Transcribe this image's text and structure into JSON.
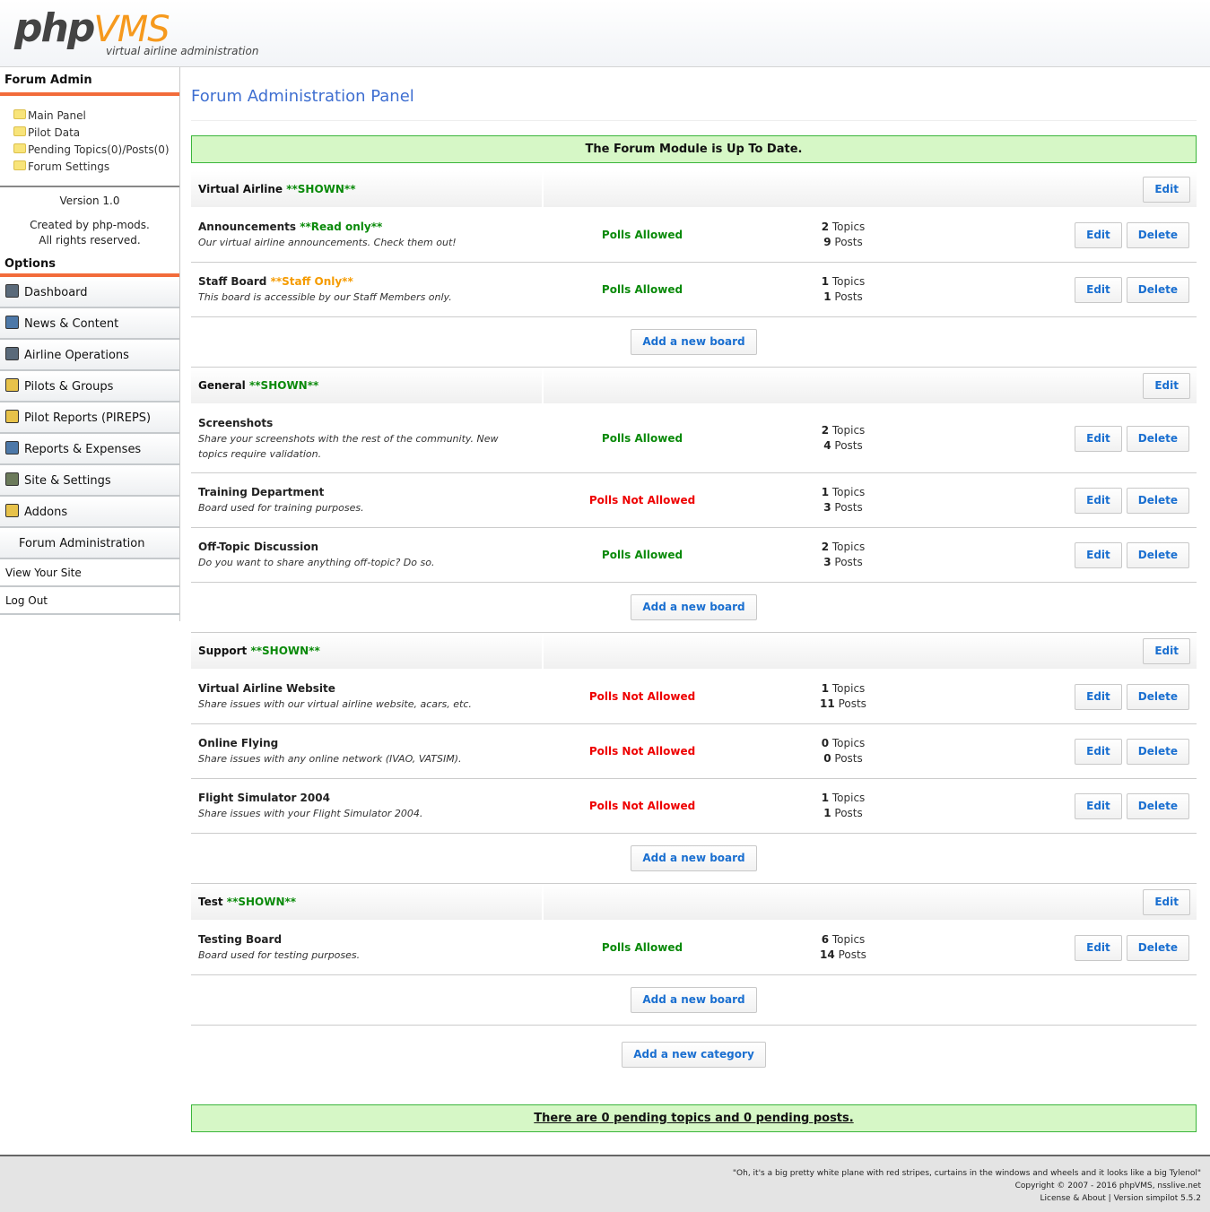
{
  "header": {
    "logo_php": "php",
    "logo_vms": "VMS",
    "tagline": "virtual airline administration"
  },
  "sidebar": {
    "title": "Forum Admin",
    "links": [
      {
        "label": "Main Panel"
      },
      {
        "label": "Pilot Data"
      },
      {
        "label": "Pending Topics(0)/Posts(0)"
      },
      {
        "label": "Forum Settings"
      }
    ],
    "version": "Version 1.0",
    "created_line1": "Created by php-mods.",
    "created_line2": "All rights reserved.",
    "options_title": "Options",
    "nav": [
      {
        "label": "Dashboard",
        "icon": "dashboard-icon"
      },
      {
        "label": "News & Content",
        "icon": "news-icon"
      },
      {
        "label": "Airline Operations",
        "icon": "airline-icon"
      },
      {
        "label": "Pilots & Groups",
        "icon": "pilots-icon"
      },
      {
        "label": "Pilot Reports (PIREPS)",
        "icon": "pireps-icon"
      },
      {
        "label": "Reports & Expenses",
        "icon": "reports-icon"
      },
      {
        "label": "Site & Settings",
        "icon": "settings-icon"
      },
      {
        "label": "Addons",
        "icon": "addons-icon"
      }
    ],
    "sub_nav": "Forum Administration",
    "view_site": "View Your Site",
    "logout": "Log Out"
  },
  "main": {
    "title": "Forum Administration Panel",
    "status_notice": "The Forum Module is Up To Date.",
    "edit_label": "Edit",
    "delete_label": "Delete",
    "add_board_label": "Add a new board",
    "add_category_label": "Add a new category",
    "topics_label": "Topics",
    "posts_label": "Posts",
    "pending_notice": "There are 0 pending topics and 0 pending posts.",
    "categories": [
      {
        "name": "Virtual Airline",
        "tag": "**SHOWN**",
        "boards": [
          {
            "name": "Announcements",
            "tag": "**Read only**",
            "tag_color": "green",
            "desc": "Our virtual airline announcements. Check them out!",
            "polls": "Polls Allowed",
            "polls_ok": true,
            "topics": "2",
            "posts": "9"
          },
          {
            "name": "Staff Board",
            "tag": "**Staff Only**",
            "tag_color": "orange",
            "desc": "This board is accessible by our Staff Members only.",
            "polls": "Polls Allowed",
            "polls_ok": true,
            "topics": "1",
            "posts": "1"
          }
        ]
      },
      {
        "name": "General",
        "tag": "**SHOWN**",
        "boards": [
          {
            "name": "Screenshots",
            "tag": "",
            "desc": "Share your screenshots with the rest of the community. New topics require validation.",
            "polls": "Polls Allowed",
            "polls_ok": true,
            "topics": "2",
            "posts": "4"
          },
          {
            "name": "Training Department",
            "tag": "",
            "desc": "Board used for training purposes.",
            "polls": "Polls Not Allowed",
            "polls_ok": false,
            "topics": "1",
            "posts": "3"
          },
          {
            "name": "Off-Topic Discussion",
            "tag": "",
            "desc": "Do you want to share anything off-topic? Do so.",
            "polls": "Polls Allowed",
            "polls_ok": true,
            "topics": "2",
            "posts": "3"
          }
        ]
      },
      {
        "name": "Support",
        "tag": "**SHOWN**",
        "boards": [
          {
            "name": "Virtual Airline Website",
            "tag": "",
            "desc": "Share issues with our virtual airline website, acars, etc.",
            "polls": "Polls Not Allowed",
            "polls_ok": false,
            "topics": "1",
            "posts": "11"
          },
          {
            "name": "Online Flying",
            "tag": "",
            "desc": "Share issues with any online network (IVAO, VATSIM).",
            "polls": "Polls Not Allowed",
            "polls_ok": false,
            "topics": "0",
            "posts": "0"
          },
          {
            "name": "Flight Simulator 2004",
            "tag": "",
            "desc": "Share issues with your Flight Simulator 2004.",
            "polls": "Polls Not Allowed",
            "polls_ok": false,
            "topics": "1",
            "posts": "1"
          }
        ]
      },
      {
        "name": "Test",
        "tag": "**SHOWN**",
        "boards": [
          {
            "name": "Testing Board",
            "tag": "",
            "desc": "Board used for testing purposes.",
            "polls": "Polls Allowed",
            "polls_ok": true,
            "topics": "6",
            "posts": "14"
          }
        ]
      }
    ]
  },
  "footer": {
    "quote": "\"Oh, it's a big pretty white plane with red stripes, curtains in the windows and wheels and it looks like a big Tylenol\"",
    "copyright": "Copyright © 2007 - 2016 phpVMS, nsslive.net",
    "license": "License & About | Version simpilot 5.5.2"
  },
  "colors": {
    "accent": "#f26b3a",
    "title_blue": "#3f6fd1",
    "notice_bg": "#d6f7c6",
    "notice_border": "#3bb63b",
    "link_blue": "#1a6fd0",
    "allowed_green": "#0a8a0a",
    "not_allowed_red": "#ee0000",
    "staff_orange": "#f59b00"
  }
}
